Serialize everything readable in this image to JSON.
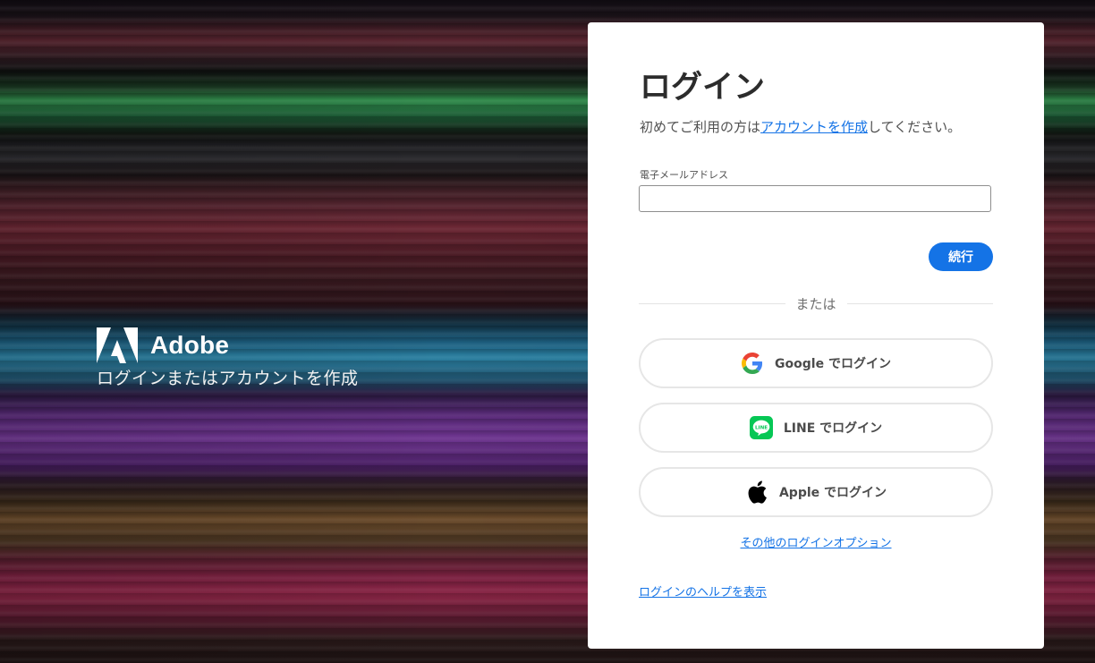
{
  "brand": {
    "name": "Adobe",
    "tagline": "ログインまたはアカウントを作成"
  },
  "login": {
    "title": "ログイン",
    "subtitle_prefix": "初めてご利用の方は",
    "subtitle_link": "アカウントを作成",
    "subtitle_suffix": "してください。",
    "email_label": "電子メールアドレス",
    "email_value": "",
    "continue_label": "続行",
    "or_label": "または",
    "google_label": "Google でログイン",
    "line_label": "LINE でログイン",
    "apple_label": "Apple でログイン",
    "more_options_label": "その他のログインオプション",
    "help_label": "ログインのヘルプを表示",
    "line_icon_text": "LINE"
  },
  "colors": {
    "accent": "#1473e6",
    "line_green": "#06c755"
  }
}
